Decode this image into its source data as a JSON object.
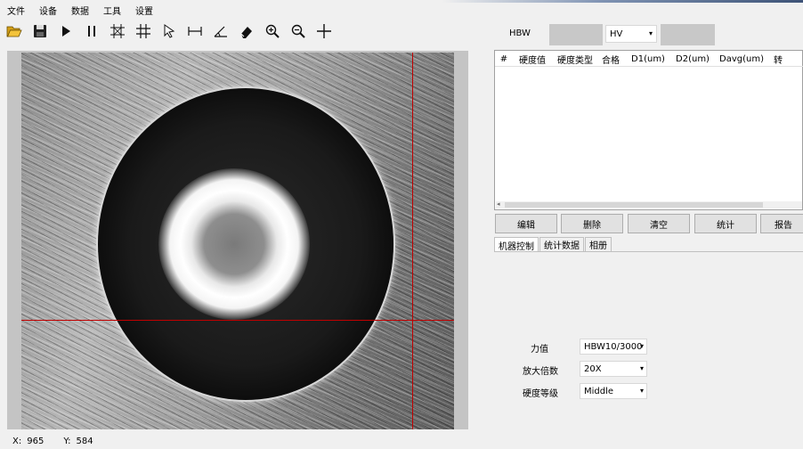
{
  "menu": [
    "文件",
    "设备",
    "数据",
    "工具",
    "设置"
  ],
  "toolbar_icons": [
    "open-folder-icon",
    "save-icon",
    "play-icon",
    "pause-icon",
    "auto-measure-icon",
    "grid-icon",
    "pointer-icon",
    "length-icon",
    "angle-icon",
    "eraser-icon",
    "zoom-in-icon",
    "zoom-out-icon",
    "crosshair-icon"
  ],
  "status": {
    "x_label": "X:",
    "x_value": "965",
    "y_label": "Y:",
    "y_value": "584"
  },
  "hardness": {
    "label": "HBW",
    "scale_selected": "HV"
  },
  "table": {
    "columns": [
      "#",
      "硬度值",
      "硬度类型",
      "合格",
      "D1(um)",
      "D2(um)",
      "Davg(um)",
      "转"
    ],
    "rows": []
  },
  "buttons": [
    "编辑",
    "删除",
    "清空",
    "统计",
    "报告"
  ],
  "tabs": [
    "机器控制",
    "统计数据",
    "相册"
  ],
  "machine_control": {
    "force_label": "力值",
    "force_value": "HBW10/3000",
    "magnification_label": "放大倍数",
    "magnification_value": "20X",
    "level_label": "硬度等级",
    "level_value": "Middle"
  },
  "colors": {
    "crosshair": "#c00000",
    "background": "#f0f0f0"
  }
}
